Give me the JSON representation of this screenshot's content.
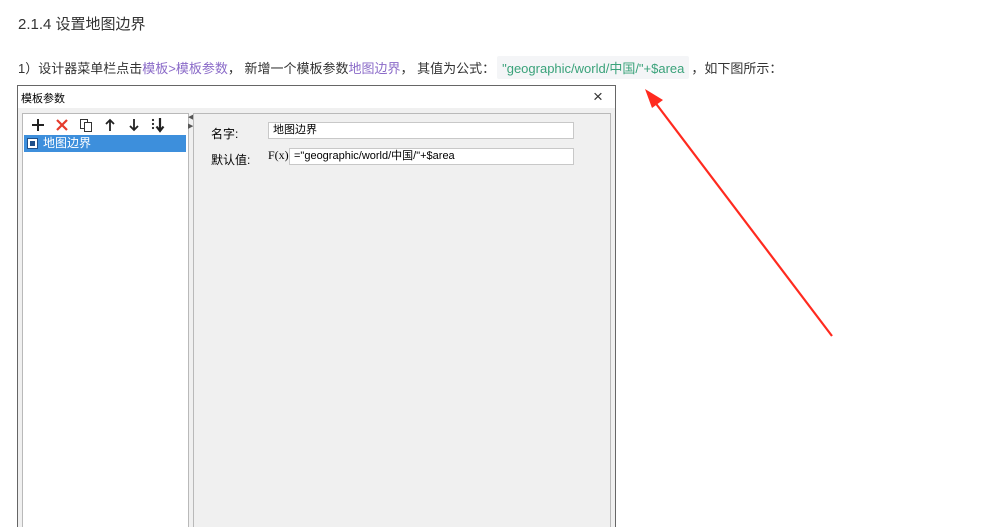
{
  "heading": "2.1.4 设置地图边界",
  "step": {
    "prefix": "1）设计器菜单栏点击 ",
    "menu_path": "模板>模板参数",
    "mid1": "， 新增一个模板参数 ",
    "param_name": "地图边界",
    "mid2": "， 其值为公式：",
    "formula": "\"geographic/world/中国/\"+$area",
    "suffix": "，如下图所示："
  },
  "dialog": {
    "title": "模板参数",
    "close_glyph": "×",
    "toolbar": {
      "add": "+",
      "delete": "✕",
      "copy": "⧉",
      "up": "↑",
      "down": "↓",
      "sort": "⇊"
    },
    "params": [
      {
        "label": "地图边界",
        "selected": true
      }
    ],
    "form": {
      "name_label": "名字:",
      "name_value": "地图边界",
      "default_label": "默认值:",
      "fx_label": "F(x)",
      "default_value": "=\"geographic/world/中国/\"+$area"
    }
  },
  "colors": {
    "link": "#8a6ac8",
    "code": "#3aa27a",
    "selection": "#3d8fdc",
    "annotation_arrow": "#ff2a1f"
  },
  "icons": [
    "add-icon",
    "delete-icon",
    "copy-icon",
    "move-up-icon",
    "move-down-icon",
    "sort-icon",
    "close-icon",
    "parameter-icon",
    "formula-icon",
    "annotation-arrow"
  ]
}
